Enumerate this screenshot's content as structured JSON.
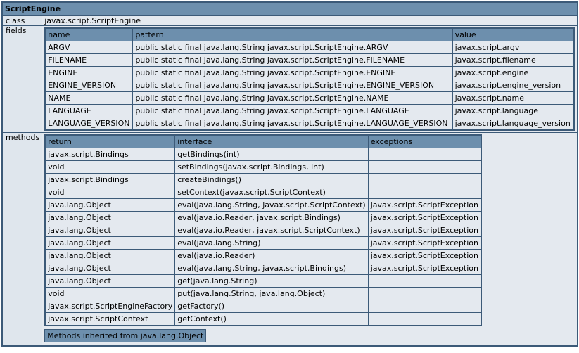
{
  "header": {
    "title": "ScriptEngine"
  },
  "class_row": {
    "label": "class",
    "value": "javax.script.ScriptEngine"
  },
  "fields": {
    "label": "fields",
    "columns": [
      "name",
      "pattern",
      "value"
    ],
    "rows": [
      [
        "ARGV",
        "public static final java.lang.String javax.script.ScriptEngine.ARGV",
        "javax.script.argv"
      ],
      [
        "FILENAME",
        "public static final java.lang.String javax.script.ScriptEngine.FILENAME",
        "javax.script.filename"
      ],
      [
        "ENGINE",
        "public static final java.lang.String javax.script.ScriptEngine.ENGINE",
        "javax.script.engine"
      ],
      [
        "ENGINE_VERSION",
        "public static final java.lang.String javax.script.ScriptEngine.ENGINE_VERSION",
        "javax.script.engine_version"
      ],
      [
        "NAME",
        "public static final java.lang.String javax.script.ScriptEngine.NAME",
        "javax.script.name"
      ],
      [
        "LANGUAGE",
        "public static final java.lang.String javax.script.ScriptEngine.LANGUAGE",
        "javax.script.language"
      ],
      [
        "LANGUAGE_VERSION",
        "public static final java.lang.String javax.script.ScriptEngine.LANGUAGE_VERSION",
        "javax.script.language_version"
      ]
    ]
  },
  "methods": {
    "label": "methods",
    "columns": [
      "return",
      "interface",
      "exceptions"
    ],
    "rows": [
      [
        "javax.script.Bindings",
        "getBindings(int)",
        ""
      ],
      [
        "void",
        "setBindings(javax.script.Bindings, int)",
        ""
      ],
      [
        "javax.script.Bindings",
        "createBindings()",
        ""
      ],
      [
        "void",
        "setContext(javax.script.ScriptContext)",
        ""
      ],
      [
        "java.lang.Object",
        "eval(java.lang.String, javax.script.ScriptContext)",
        "javax.script.ScriptException"
      ],
      [
        "java.lang.Object",
        "eval(java.io.Reader, javax.script.Bindings)",
        "javax.script.ScriptException"
      ],
      [
        "java.lang.Object",
        "eval(java.io.Reader, javax.script.ScriptContext)",
        "javax.script.ScriptException"
      ],
      [
        "java.lang.Object",
        "eval(java.lang.String)",
        "javax.script.ScriptException"
      ],
      [
        "java.lang.Object",
        "eval(java.io.Reader)",
        "javax.script.ScriptException"
      ],
      [
        "java.lang.Object",
        "eval(java.lang.String, javax.script.Bindings)",
        "javax.script.ScriptException"
      ],
      [
        "java.lang.Object",
        "get(java.lang.String)",
        ""
      ],
      [
        "void",
        "put(java.lang.String, java.lang.Object)",
        ""
      ],
      [
        "javax.script.ScriptEngineFactory",
        "getFactory()",
        ""
      ],
      [
        "javax.script.ScriptContext",
        "getContext()",
        ""
      ]
    ],
    "inherited_label": "Methods inherited from java.lang.Object"
  },
  "colors": {
    "header_bg": "#6d8fad",
    "border": "#3c5a78",
    "cell_bg": "#e4e9ef"
  }
}
